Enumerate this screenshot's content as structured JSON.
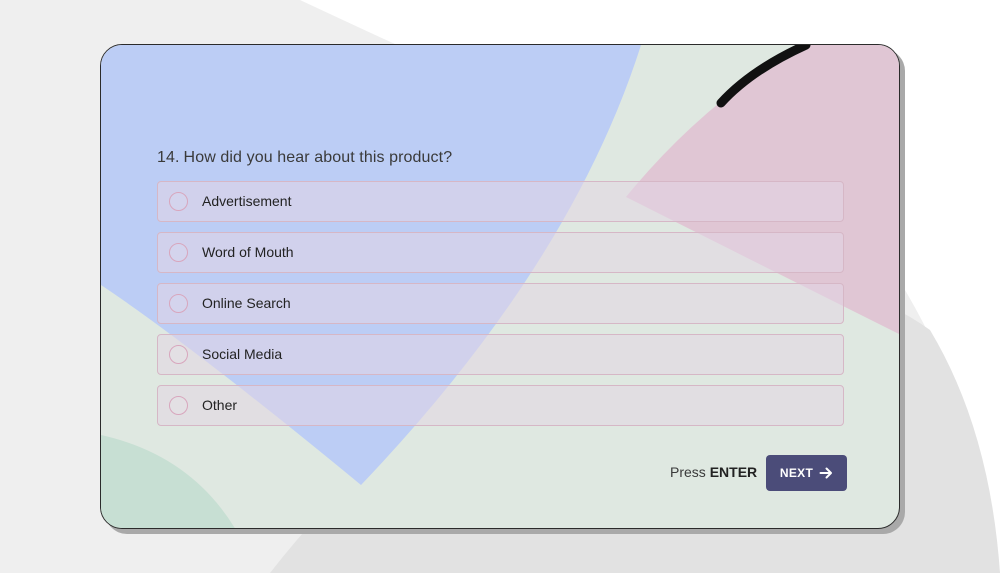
{
  "question": {
    "number": "14.",
    "text": "How did you hear about this product?"
  },
  "options": [
    {
      "label": "Advertisement"
    },
    {
      "label": "Word of Mouth"
    },
    {
      "label": "Online Search"
    },
    {
      "label": "Social Media"
    },
    {
      "label": "Other"
    }
  ],
  "footer": {
    "hint_prefix": "Press",
    "hint_key": "ENTER",
    "next_label": "NEXT",
    "next_icon": "arrow-right-icon"
  },
  "colors": {
    "accent_button": "#4b4c79",
    "option_border": "#d6b7c6",
    "blue_shape": "#bccdf5",
    "pink_shape": "#e0c6d4",
    "green_shape": "#c7dfd3"
  }
}
